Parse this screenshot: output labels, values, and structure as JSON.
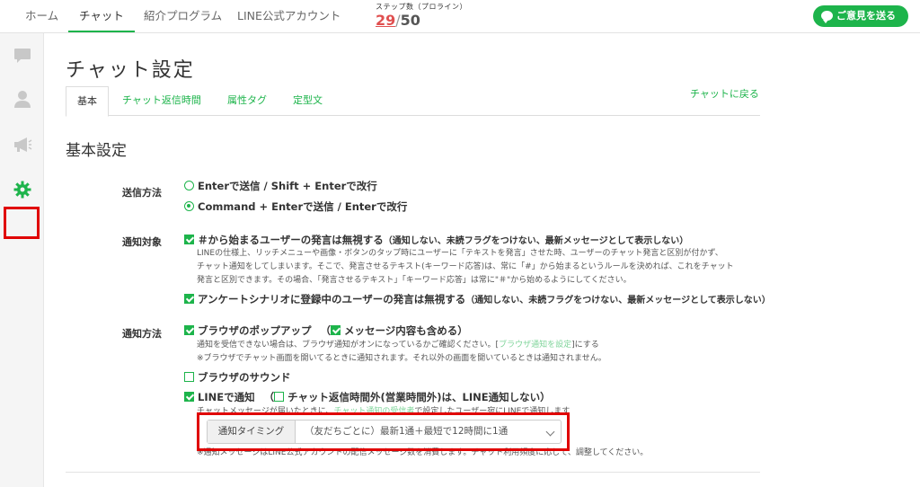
{
  "nav": {
    "items": [
      "ホーム",
      "チャット",
      "紹介プログラム",
      "LINE公式アカウント"
    ],
    "step_label": "ステップ数（プロライン）",
    "step_used": "29",
    "step_sep": "/",
    "step_total": "50",
    "feedback_label": "ご意見を送る"
  },
  "page": {
    "title": "チャット設定",
    "tabs": [
      "基本",
      "チャット返信時間",
      "属性タグ",
      "定型文"
    ],
    "back_link": "チャットに戻る",
    "section_title": "基本設定"
  },
  "send": {
    "label": "送信方法",
    "option1": "Enterで送信 / Shift + Enterで改行",
    "option2": "Command + Enterで送信 / Enterで改行"
  },
  "target": {
    "label": "通知対象",
    "opt1": "＃から始まるユーザーの発言は無視する",
    "opt1_note": "（通知しない、未読フラグをつけない、最新メッセージとして表示しない）",
    "desc1": "LINEの仕様上、リッチメニューや画像・ボタンのタップ時にユーザーに「テキストを発言」させた時、ユーザーのチャット発言と区別が付かず、",
    "desc2": "チャット通知をしてしまいます。そこで、発言させるテキスト(キーワード応答)は、常に「#」から始まるというルールを決めれば、これをチャット",
    "desc3": "発言と区別できます。その場合、「発言させるテキスト」「キーワード応答」は常に\"＃\"から始めるようにしてください。",
    "opt2": "アンケートシナリオに登録中のユーザーの発言は無視する",
    "opt2_note": "（通知しない、未読フラグをつけない、最新メッセージとして表示しない）"
  },
  "method": {
    "label": "通知方法",
    "browser_popup": "ブラウザのポップアップ",
    "open_paren": "（",
    "include_msg": "メッセージ内容も含める",
    "close_paren": "）",
    "popup_desc1_a": "通知を受信できない場合は、ブラウザ通知がオンになっているかご確認ください。[",
    "popup_desc1_link": "ブラウザ通知を設定",
    "popup_desc1_b": "]にする",
    "popup_desc2": "※ブラウザでチャット画面を開いてるときに通知されます。それ以外の画面を開いているときは通知されません。",
    "browser_sound": "ブラウザのサウンド",
    "line_notify": "LINEで通知",
    "line_open_paren": "（",
    "outside_hours": "チャット返信時間外(営業時間外)は、LINE通知しない",
    "line_close_paren": "）",
    "line_desc1_a": "チャットメッセージが届いたときに、",
    "line_desc1_link": "チャット通知の受信者",
    "line_desc1_b": "で設定したユーザー宛にLINEで通知します",
    "line_desc2": "※通知メッセージはLINE公式アカウントの配信メッセージ数を消費します。チャット利用頻度に応じて、調整してください。",
    "timing_label": "通知タイミング",
    "timing_value": "（友だちごとに）最新1通＋最短で12時間に1通"
  }
}
